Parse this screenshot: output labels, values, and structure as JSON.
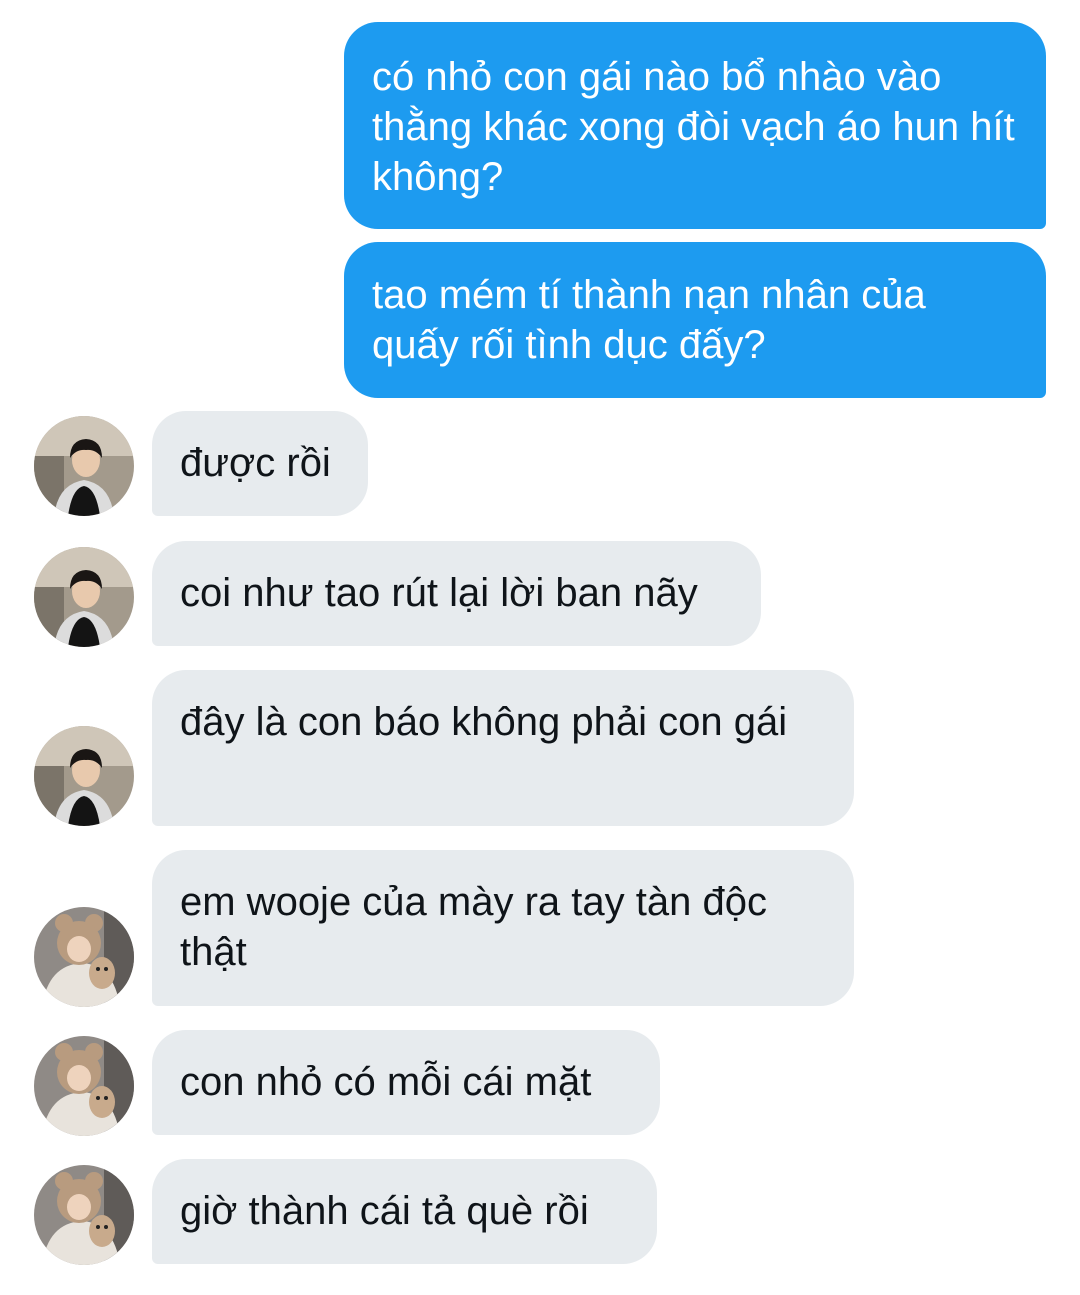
{
  "conversation": {
    "messages": [
      {
        "sender": "me",
        "text": "có nhỏ con gái nào bổ nhào vào thằng khác xong đòi vạch áo hun hít không?"
      },
      {
        "sender": "me",
        "text": "tao mém tí thành nạn nhân của quấy rối tình dục đấy?"
      },
      {
        "sender": "boy-avatar",
        "text": "được rồi"
      },
      {
        "sender": "boy-avatar",
        "text": "coi như tao rút lại lời ban nãy"
      },
      {
        "sender": "boy-avatar",
        "text": "đây là con báo không phải con gái"
      },
      {
        "sender": "bear-hat-avatar",
        "text": "em wooje của mày ra tay tàn độc thật"
      },
      {
        "sender": "bear-hat-avatar",
        "text": "con nhỏ có mỗi cái mặt"
      },
      {
        "sender": "bear-hat-avatar",
        "text": "giờ thành cái tả què rồi"
      }
    ]
  },
  "colors": {
    "outgoing_bubble": "#1d9bf0",
    "incoming_bubble": "#e7ebee",
    "outgoing_text": "#ffffff",
    "incoming_text": "#0f1419"
  }
}
